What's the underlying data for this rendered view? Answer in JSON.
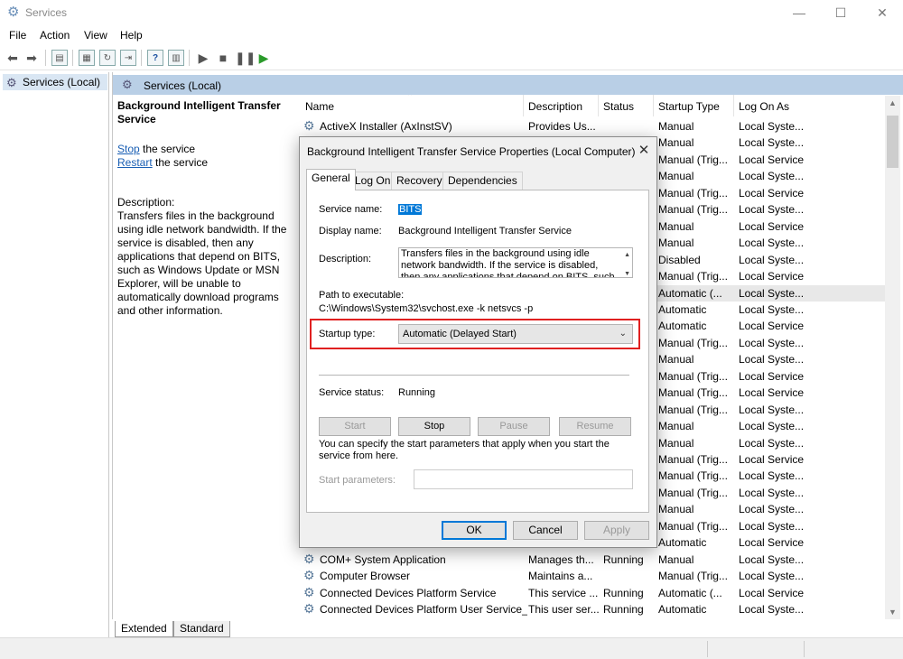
{
  "window": {
    "title": "Services",
    "minimize": "—",
    "maximize": "☐",
    "close": "✕"
  },
  "menu": [
    "File",
    "Action",
    "View",
    "Help"
  ],
  "tree": {
    "root_label": "Services (Local)"
  },
  "main": {
    "header": "Services (Local)",
    "selected_service_title": "Background Intelligent Transfer Service",
    "stop_link": "Stop",
    "stop_suffix": " the service",
    "restart_link": "Restart",
    "restart_suffix": " the service",
    "description_label": "Description:",
    "description_text": "Transfers files in the background using idle network bandwidth. If the service is disabled, then any applications that depend on BITS, such as Windows Update or MSN Explorer, will be unable to automatically download programs and other information."
  },
  "columns": [
    "Name",
    "Description",
    "Status",
    "Startup Type",
    "Log On As"
  ],
  "services": [
    {
      "name": "ActiveX Installer (AxInstSV)",
      "description": "Provides Us...",
      "status": "",
      "startup": "Manual",
      "logon": "Local Syste..."
    },
    {
      "name": "",
      "description": "",
      "status": "",
      "startup": "Manual",
      "logon": "Local Syste..."
    },
    {
      "name": "",
      "description": "",
      "status": "",
      "startup": "Manual (Trig...",
      "logon": "Local Service"
    },
    {
      "name": "",
      "description": "",
      "status": "",
      "startup": "Manual",
      "logon": "Local Syste..."
    },
    {
      "name": "",
      "description": "",
      "status": "",
      "startup": "Manual (Trig...",
      "logon": "Local Service"
    },
    {
      "name": "",
      "description": "",
      "status": "",
      "startup": "Manual (Trig...",
      "logon": "Local Syste..."
    },
    {
      "name": "",
      "description": "",
      "status": "",
      "startup": "Manual",
      "logon": "Local Service"
    },
    {
      "name": "",
      "description": "",
      "status": "",
      "startup": "Manual",
      "logon": "Local Syste..."
    },
    {
      "name": "",
      "description": "",
      "status": "",
      "startup": "Disabled",
      "logon": "Local Syste..."
    },
    {
      "name": "",
      "description": "",
      "status": "",
      "startup": "Manual (Trig...",
      "logon": "Local Service"
    },
    {
      "name": "",
      "description": "",
      "status": "",
      "startup": "Automatic (...",
      "logon": "Local Syste...",
      "selected": true
    },
    {
      "name": "",
      "description": "",
      "status": "",
      "startup": "Automatic",
      "logon": "Local Syste..."
    },
    {
      "name": "",
      "description": "",
      "status": "",
      "startup": "Automatic",
      "logon": "Local Service"
    },
    {
      "name": "",
      "description": "",
      "status": "",
      "startup": "Manual (Trig...",
      "logon": "Local Syste..."
    },
    {
      "name": "",
      "description": "",
      "status": "",
      "startup": "Manual",
      "logon": "Local Syste..."
    },
    {
      "name": "",
      "description": "",
      "status": "",
      "startup": "Manual (Trig...",
      "logon": "Local Service"
    },
    {
      "name": "",
      "description": "",
      "status": "",
      "startup": "Manual (Trig...",
      "logon": "Local Service"
    },
    {
      "name": "",
      "description": "",
      "status": "",
      "startup": "Manual (Trig...",
      "logon": "Local Syste..."
    },
    {
      "name": "",
      "description": "",
      "status": "",
      "startup": "Manual",
      "logon": "Local Syste..."
    },
    {
      "name": "",
      "description": "",
      "status": "",
      "startup": "Manual",
      "logon": "Local Syste..."
    },
    {
      "name": "",
      "description": "",
      "status": "",
      "startup": "Manual (Trig...",
      "logon": "Local Service"
    },
    {
      "name": "",
      "description": "",
      "status": "",
      "startup": "Manual (Trig...",
      "logon": "Local Syste..."
    },
    {
      "name": "",
      "description": "",
      "status": "",
      "startup": "Manual (Trig...",
      "logon": "Local Syste..."
    },
    {
      "name": "",
      "description": "",
      "status": "",
      "startup": "Manual",
      "logon": "Local Syste..."
    },
    {
      "name": "",
      "description": "",
      "status": "",
      "startup": "Manual (Trig...",
      "logon": "Local Syste..."
    },
    {
      "name": "",
      "description": "",
      "status": "",
      "startup": "Automatic",
      "logon": "Local Service"
    },
    {
      "name": "COM+ System Application",
      "description": "Manages th...",
      "status": "Running",
      "startup": "Manual",
      "logon": "Local Syste..."
    },
    {
      "name": "Computer Browser",
      "description": "Maintains a...",
      "status": "",
      "startup": "Manual (Trig...",
      "logon": "Local Syste..."
    },
    {
      "name": "Connected Devices Platform Service",
      "description": "This service ...",
      "status": "Running",
      "startup": "Automatic (...",
      "logon": "Local Service"
    },
    {
      "name": "Connected Devices Platform User Service_...",
      "description": "This user ser...",
      "status": "Running",
      "startup": "Automatic",
      "logon": "Local Syste..."
    }
  ],
  "bottom_tabs": [
    "Extended",
    "Standard"
  ],
  "dialog": {
    "title": "Background Intelligent Transfer Service Properties (Local Computer)",
    "close": "✕",
    "tabs": [
      "General",
      "Log On",
      "Recovery",
      "Dependencies"
    ],
    "service_name_label": "Service name:",
    "service_name": "BITS",
    "display_name_label": "Display name:",
    "display_name": "Background Intelligent Transfer Service",
    "description_label": "Description:",
    "description": "Transfers files in the background using idle network bandwidth. If the service is disabled, then any applications that depend on BITS, such as Windows",
    "path_label": "Path to executable:",
    "path": "C:\\Windows\\System32\\svchost.exe -k netsvcs -p",
    "startup_type_label": "Startup type:",
    "startup_type": "Automatic (Delayed Start)",
    "service_status_label": "Service status:",
    "service_status": "Running",
    "start_button": "Start",
    "stop_button": "Stop",
    "pause_button": "Pause",
    "resume_button": "Resume",
    "params_hint": "You can specify the start parameters that apply when you start the service from here.",
    "start_params_label": "Start parameters:",
    "ok_button": "OK",
    "cancel_button": "Cancel",
    "apply_button": "Apply"
  },
  "colors": {
    "header_blue": "#b9cfe6",
    "highlight": "#0078d7",
    "callout_red": "#e02020"
  }
}
